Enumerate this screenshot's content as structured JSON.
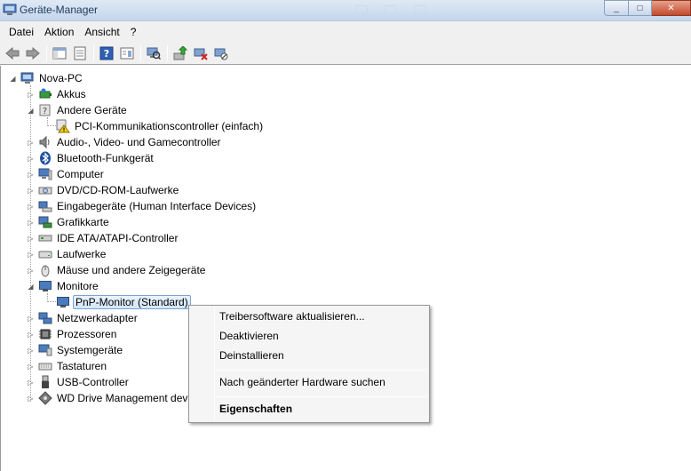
{
  "window": {
    "title": "Geräte-Manager",
    "controls": {
      "minimize": "_",
      "maximize": "□",
      "close": "✕"
    }
  },
  "menubar": {
    "items": [
      "Datei",
      "Aktion",
      "Ansicht",
      "?"
    ]
  },
  "toolbar": {
    "buttons": [
      "back-icon",
      "forward-icon",
      "console-tree-icon",
      "properties-icon",
      "help-icon",
      "view-icon",
      "scan-hardware-icon",
      "update-driver-icon",
      "uninstall-icon",
      "disable-icon"
    ]
  },
  "tree": {
    "root": "Nova-PC",
    "items": [
      "Akkus",
      "Andere Geräte",
      "PCI-Kommunikationscontroller (einfach)",
      "Audio-, Video- und Gamecontroller",
      "Bluetooth-Funkgerät",
      "Computer",
      "DVD/CD-ROM-Laufwerke",
      "Eingabegeräte (Human Interface Devices)",
      "Grafikkarte",
      "IDE ATA/ATAPI-Controller",
      "Laufwerke",
      "Mäuse und andere Zeigegeräte",
      "Monitore",
      "PnP-Monitor (Standard)",
      "Netzwerkadapter",
      "Prozessoren",
      "Systemgeräte",
      "Tastaturen",
      "USB-Controller",
      "WD Drive Management devi"
    ]
  },
  "context_menu": {
    "items": [
      "Treibersoftware aktualisieren...",
      "Deaktivieren",
      "Deinstallieren",
      "Nach geänderter Hardware suchen",
      "Eigenschaften"
    ]
  },
  "colors": {
    "selection_border": "#7da2ce",
    "titlebar": "#c4d6ec",
    "close_button": "#c24a2d"
  }
}
